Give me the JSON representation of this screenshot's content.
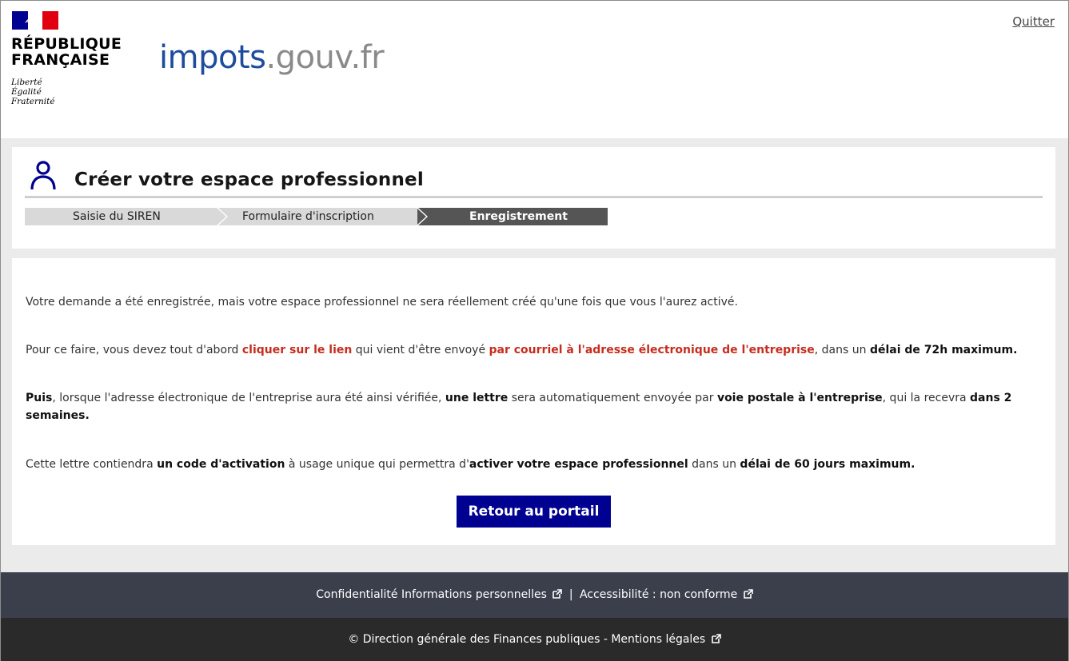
{
  "header": {
    "republic_line1": "RÉPUBLIQUE",
    "republic_line2": "FRANÇAISE",
    "motto_1": "Liberté",
    "motto_2": "Égalité",
    "motto_3": "Fraternité",
    "logo_part1": "impots",
    "logo_part2": ".gouv.fr",
    "quit_label": "Quitter"
  },
  "title_card": {
    "title": "Créer votre espace professionnel",
    "steps": [
      {
        "label": "Saisie du SIREN",
        "state": "done"
      },
      {
        "label": "Formulaire d'inscription",
        "state": "done"
      },
      {
        "label": "Enregistrement",
        "state": "current"
      }
    ]
  },
  "content": {
    "p1": "Votre demande a été enregistrée, mais votre espace professionnel ne sera réellement créé qu'une fois que vous l'aurez activé.",
    "p2_a": "Pour ce faire, vous devez tout d'abord ",
    "p2_b": "cliquer sur le lien",
    "p2_c": " qui vient d'être envoyé ",
    "p2_d": "par courriel à l'adresse électronique de l'entreprise",
    "p2_e": ", dans un ",
    "p2_f": "délai de 72h maximum.",
    "p3_a": "Puis",
    "p3_b": ", lorsque l'adresse électronique de l'entreprise aura été ainsi vérifiée, ",
    "p3_c": "une lettre",
    "p3_d": " sera automatiquement envoyée par ",
    "p3_e": "voie postale à l'entreprise",
    "p3_f": ", qui la recevra ",
    "p3_g": "dans 2 semaines.",
    "p4_a": "Cette lettre contiendra ",
    "p4_b": "un code d'activation",
    "p4_c": " à usage unique qui permettra d'",
    "p4_d": "activer votre espace professionnel",
    "p4_e": " dans un ",
    "p4_f": "délai de 60 jours maximum.",
    "button_label": "Retour au portail"
  },
  "footer": {
    "privacy_label": "Confidentialité Informations personnelles",
    "separator": "|",
    "accessibility_label": "Accessibilité : non conforme",
    "copyright_label": "© Direction générale des Finances publiques - Mentions légales"
  },
  "colors": {
    "brand_blue": "#000091",
    "alert_red": "#c62d1f",
    "footer_top": "#3a3f4b",
    "footer_bottom": "#2a2a2a",
    "step_current": "#555555",
    "step_done": "#d9d9d9"
  }
}
